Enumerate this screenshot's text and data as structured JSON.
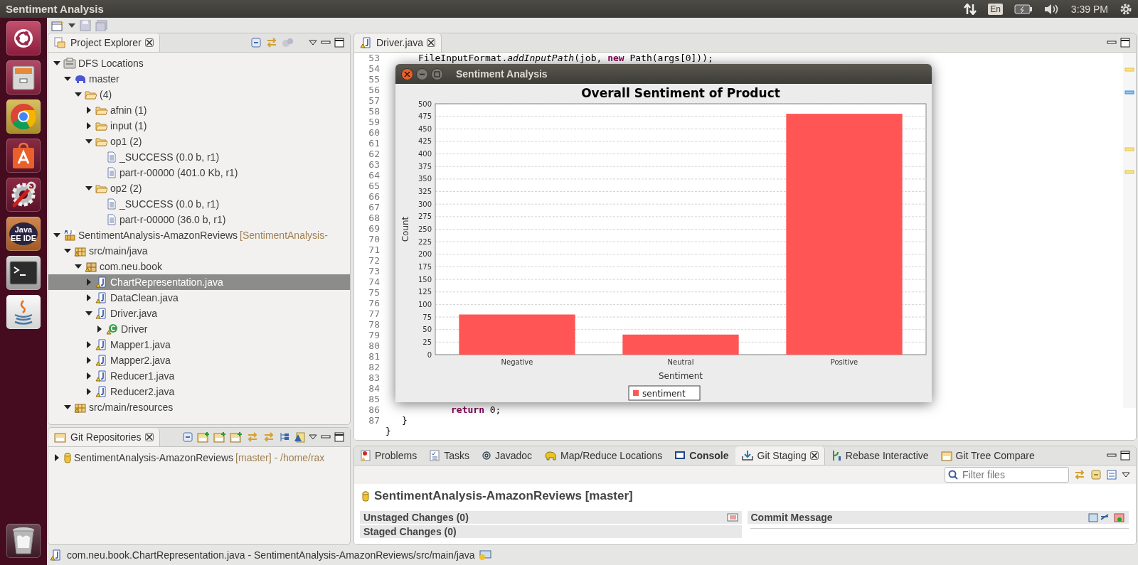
{
  "topbar": {
    "title": "Sentiment Analysis",
    "keyboard": "En",
    "clock": "3:39 PM"
  },
  "launcher": {
    "items": [
      {
        "kind": "ubuntu"
      },
      {
        "kind": "files"
      },
      {
        "kind": "chrome"
      },
      {
        "kind": "software"
      },
      {
        "kind": "settings"
      },
      {
        "kind": "ide",
        "label": "Java EE IDE"
      },
      {
        "kind": "terminal"
      },
      {
        "kind": "java"
      },
      {
        "kind": "trash"
      }
    ]
  },
  "project_explorer": {
    "tab": {
      "label": "Project Explorer",
      "selected": true
    },
    "tree": [
      {
        "label": "DFS Locations",
        "kind": "dfs",
        "expanded": true,
        "selected": false,
        "children": [
          {
            "label": "master",
            "kind": "hadoop",
            "expanded": true,
            "selected": false,
            "children": [
              {
                "label": "(4)",
                "kind": "folder",
                "expanded": true,
                "selected": false,
                "children": [
                  {
                    "label": "afnin (1)",
                    "kind": "folder",
                    "expanded": false,
                    "selected": false
                  },
                  {
                    "label": "input (1)",
                    "kind": "folder",
                    "expanded": false,
                    "selected": false
                  },
                  {
                    "label": "op1 (2)",
                    "kind": "folder",
                    "expanded": true,
                    "selected": false,
                    "children": [
                      {
                        "label": "_SUCCESS (0.0 b, r1)",
                        "kind": "file",
                        "selected": false
                      },
                      {
                        "label": "part-r-00000 (401.0 Kb, r1)",
                        "kind": "file",
                        "selected": false
                      }
                    ]
                  },
                  {
                    "label": "op2 (2)",
                    "kind": "folder",
                    "expanded": true,
                    "selected": false,
                    "children": [
                      {
                        "label": "_SUCCESS (0.0 b, r1)",
                        "kind": "file",
                        "selected": false
                      },
                      {
                        "label": "part-r-00000 (36.0 b, r1)",
                        "kind": "file",
                        "selected": false
                      }
                    ]
                  }
                ]
              }
            ]
          }
        ]
      },
      {
        "label": "SentimentAnalysis-AmazonReviews",
        "decoration": "[SentimentAnalysis-",
        "kind": "project",
        "expanded": true,
        "selected": false,
        "children": [
          {
            "label": "src/main/java",
            "kind": "source-folder",
            "expanded": true,
            "selected": false,
            "children": [
              {
                "label": "com.neu.book",
                "kind": "package",
                "expanded": true,
                "selected": false,
                "children": [
                  {
                    "label": "ChartRepresentation.java",
                    "kind": "java-file",
                    "expanded": false,
                    "selected": true
                  },
                  {
                    "label": "DataClean.java",
                    "kind": "java-file",
                    "expanded": false,
                    "selected": false
                  },
                  {
                    "label": "Driver.java",
                    "kind": "java-file",
                    "expanded": true,
                    "selected": false,
                    "children": [
                      {
                        "label": "Driver",
                        "kind": "class",
                        "expanded": false,
                        "selected": false
                      }
                    ]
                  },
                  {
                    "label": "Mapper1.java",
                    "kind": "java-file",
                    "expanded": false,
                    "selected": false
                  },
                  {
                    "label": "Mapper2.java",
                    "kind": "java-file",
                    "expanded": false,
                    "selected": false
                  },
                  {
                    "label": "Reducer1.java",
                    "kind": "java-file",
                    "expanded": false,
                    "selected": false
                  },
                  {
                    "label": "Reducer2.java",
                    "kind": "java-file",
                    "expanded": false,
                    "selected": false
                  }
                ]
              }
            ]
          },
          {
            "label": "src/main/resources",
            "kind": "source-folder",
            "expanded": true,
            "selected": false
          }
        ]
      }
    ]
  },
  "git_repositories": {
    "tab": {
      "label": "Git Repositories",
      "selected": true
    },
    "tree": [
      {
        "label": "SentimentAnalysis-AmazonReviews",
        "decoration": "[master] - /home/rax",
        "kind": "repository",
        "expanded": false,
        "selected": false
      }
    ]
  },
  "editor": {
    "tab": {
      "label": "Driver.java",
      "selected": true
    },
    "lines": [
      {
        "number": "53",
        "code": "\t\tFileInputFormat.*addInputPath*(job, **new** Path(args[0]));"
      },
      {
        "number": "54"
      },
      {
        "number": "55"
      },
      {
        "number": "56"
      },
      {
        "number": "57"
      },
      {
        "number": "58"
      },
      {
        "number": "59"
      },
      {
        "number": "60"
      },
      {
        "number": "61"
      },
      {
        "number": "62"
      },
      {
        "number": "63"
      },
      {
        "number": "64"
      },
      {
        "number": "65"
      },
      {
        "number": "66"
      },
      {
        "number": "67"
      },
      {
        "number": "68"
      },
      {
        "number": "69"
      },
      {
        "number": "70"
      },
      {
        "number": "71"
      },
      {
        "number": "72"
      },
      {
        "number": "73"
      },
      {
        "number": "74"
      },
      {
        "number": "75"
      },
      {
        "number": "76"
      },
      {
        "number": "77"
      },
      {
        "number": "78"
      },
      {
        "number": "79"
      },
      {
        "number": "80"
      },
      {
        "number": "81"
      },
      {
        "number": "82"
      },
      {
        "number": "83"
      },
      {
        "number": "84"
      },
      {
        "number": "85"
      },
      {
        "number": "86",
        "code": "\t\t\t\t**return** 0;"
      },
      {
        "number": "87",
        "code": "\t}"
      },
      {
        "code": "}"
      }
    ]
  },
  "dialog": {
    "title": "Sentiment Analysis",
    "chart_data": {
      "type": "bar",
      "title": "Overall Sentiment of Product",
      "xlabel": "Sentiment",
      "ylabel": "Count",
      "categories": [
        "Negative",
        "Neutral",
        "Positive"
      ],
      "series": [
        {
          "name": "sentiment",
          "color": "#ff5555",
          "values": [
            80,
            40,
            480
          ]
        }
      ],
      "grid": true,
      "ylim": [
        0,
        500
      ],
      "yticks": [
        0,
        25,
        50,
        75,
        100,
        125,
        150,
        175,
        200,
        225,
        250,
        275,
        300,
        325,
        350,
        375,
        400,
        425,
        450,
        475,
        500
      ]
    }
  },
  "bottom_panel": {
    "tabs": [
      {
        "label": "Problems",
        "kind": "problems",
        "selected": false,
        "emphasized": false
      },
      {
        "label": "Tasks",
        "kind": "tasks",
        "selected": false,
        "emphasized": false
      },
      {
        "label": "Javadoc",
        "kind": "javadoc",
        "selected": false,
        "emphasized": false
      },
      {
        "label": "Map/Reduce Locations",
        "kind": "mapreduce",
        "selected": false,
        "emphasized": false
      },
      {
        "label": "Console",
        "kind": "console",
        "selected": false,
        "emphasized": true
      },
      {
        "label": "Git Staging",
        "kind": "staging",
        "selected": true,
        "emphasized": false
      },
      {
        "label": "Rebase Interactive",
        "kind": "rebase",
        "selected": false,
        "emphasized": false
      },
      {
        "label": "Git Tree Compare",
        "kind": "compare",
        "selected": false,
        "emphasized": false
      }
    ],
    "filter": {
      "placeholder": "Filter files"
    },
    "repository": "SentimentAnalysis-AmazonReviews [master]",
    "sections": [
      "Unstaged Changes (0)",
      "Staged Changes (0)"
    ],
    "commit_title": "Commit Message"
  },
  "status_bar": {
    "text": "com.neu.book.ChartRepresentation.java - SentimentAnalysis-AmazonReviews/src/main/java"
  }
}
